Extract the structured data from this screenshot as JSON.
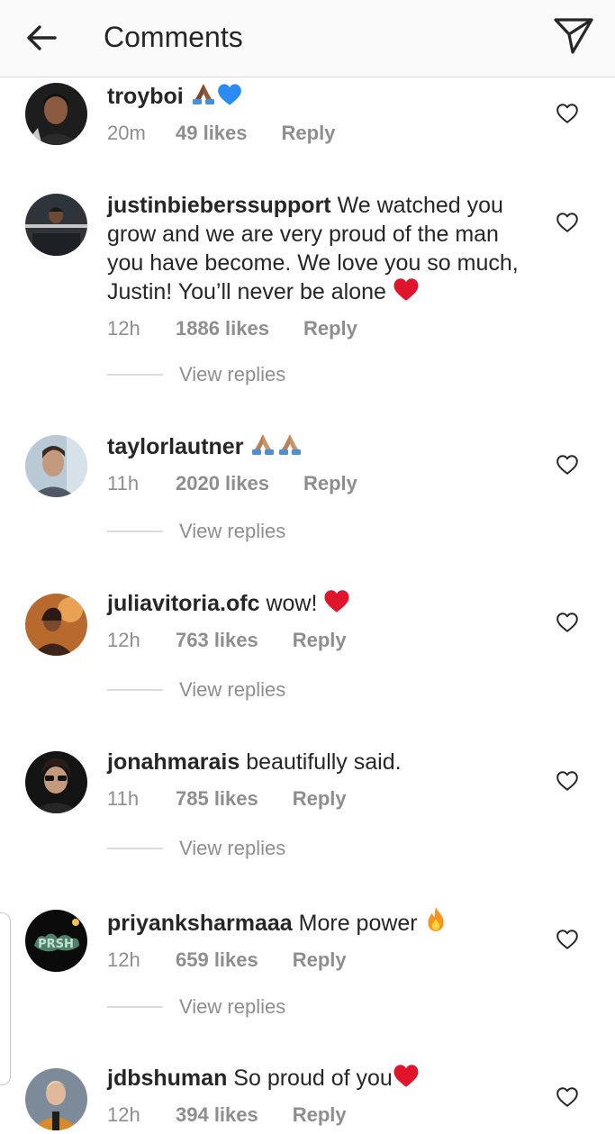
{
  "header": {
    "title": "Comments",
    "back_icon": "arrow-left-icon",
    "share_icon": "paper-plane-icon"
  },
  "reply_label": "Reply",
  "view_replies_label": "View replies",
  "comments": [
    {
      "username": "troyboi",
      "text": "",
      "emoji": [
        "folded-hands-dark",
        "blue-heart"
      ],
      "time": "20m",
      "likes": "49 likes"
    },
    {
      "username": "justinbieberssupport",
      "text": "We watched you grow and we are very proud of the man you have become. We love you so much, Justin! You’ll never be alone",
      "emoji": [
        "red-heart"
      ],
      "time": "12h",
      "likes": "1886 likes"
    },
    {
      "username": "taylorlautner",
      "text": "",
      "emoji": [
        "folded-hands-medium",
        "folded-hands-medium"
      ],
      "time": "11h",
      "likes": "2020 likes"
    },
    {
      "username": "juliavitoria.ofc",
      "text": "wow!",
      "emoji": [
        "red-heart"
      ],
      "time": "12h",
      "likes": "763 likes"
    },
    {
      "username": "jonahmarais",
      "text": "beautifully said.",
      "emoji": [],
      "time": "11h",
      "likes": "785 likes"
    },
    {
      "username": "priyanksharmaaa",
      "text": "More power",
      "emoji": [
        "fire"
      ],
      "time": "12h",
      "likes": "659 likes"
    },
    {
      "username": "jdbshuman",
      "text": "So proud of you",
      "emoji": [
        "red-heart"
      ],
      "time": "12h",
      "likes": "394 likes"
    }
  ],
  "colors": {
    "text": "#262626",
    "secondary": "#8e8e8e",
    "header_bg": "#fafafa",
    "divider": "#dbdbdb",
    "heart_red": "#e0152b",
    "blue_heart": "#2b8bf2"
  }
}
